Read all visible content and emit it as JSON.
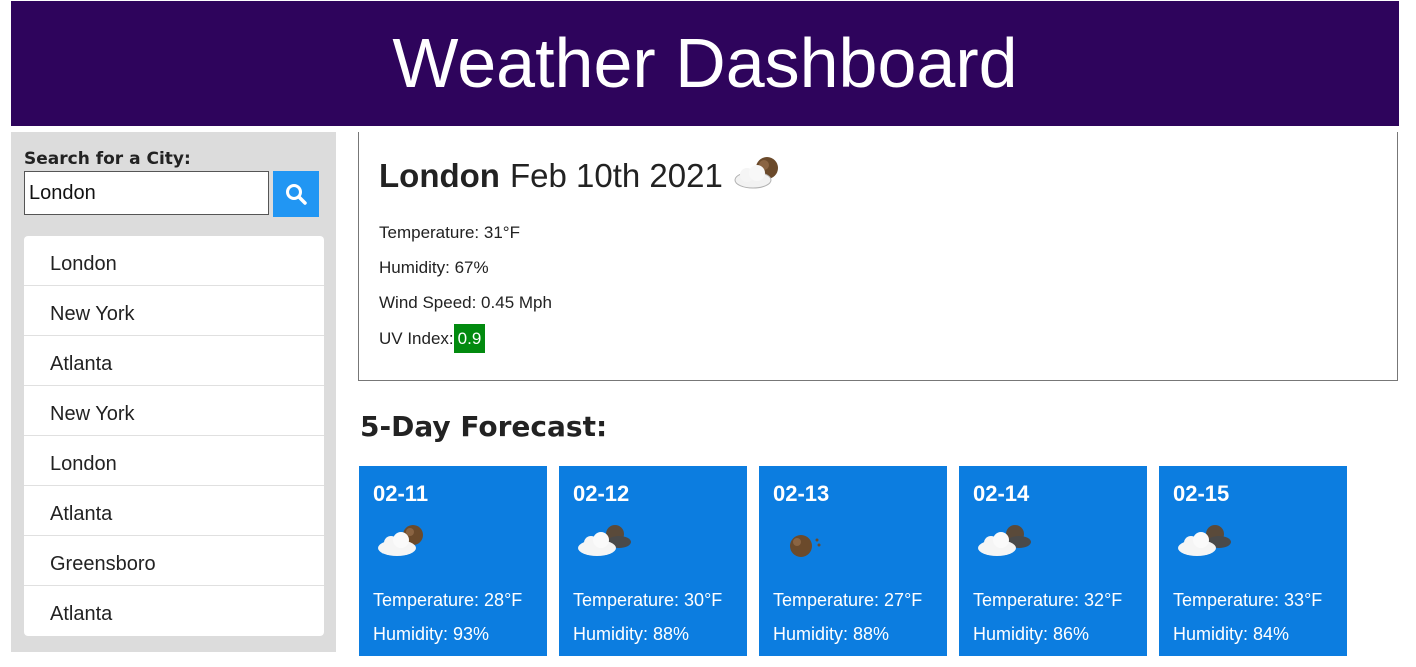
{
  "header": {
    "title": "Weather Dashboard"
  },
  "colors": {
    "header_bg": "#2e045c",
    "search_button": "#2196f3",
    "forecast_card": "#0c7de0",
    "uv_good": "#028a0f",
    "sidebar_bg": "#dcdcdc"
  },
  "search": {
    "label": "Search for a City:",
    "value": "London",
    "button_icon": "search-icon"
  },
  "history": [
    "London",
    "New York",
    "Atlanta",
    "New York",
    "London",
    "Atlanta",
    "Greensboro",
    "Atlanta"
  ],
  "current": {
    "city": "London",
    "date": "Feb 10th 2021",
    "icon": "night-cloud-icon",
    "temperature": "Temperature: 31°F",
    "humidity": "Humidity: 67%",
    "wind": "Wind Speed: 0.45 Mph",
    "uv_label": "UV Index:",
    "uv_value": "0.9"
  },
  "forecast": {
    "title": "5-Day Forecast:",
    "days": [
      {
        "date": "02-11",
        "icon": "night-cloud-icon",
        "temp": "Temperature: 28°F",
        "humidity": "Humidity: 93%"
      },
      {
        "date": "02-12",
        "icon": "night-dark-cloud-icon",
        "temp": "Temperature: 30°F",
        "humidity": "Humidity: 88%"
      },
      {
        "date": "02-13",
        "icon": "night-clear-icon",
        "temp": "Temperature: 27°F",
        "humidity": "Humidity: 88%"
      },
      {
        "date": "02-14",
        "icon": "night-dark-cloud-icon",
        "temp": "Temperature: 32°F",
        "humidity": "Humidity: 86%"
      },
      {
        "date": "02-15",
        "icon": "night-dark-cloud-icon",
        "temp": "Temperature: 33°F",
        "humidity": "Humidity: 84%"
      }
    ]
  }
}
